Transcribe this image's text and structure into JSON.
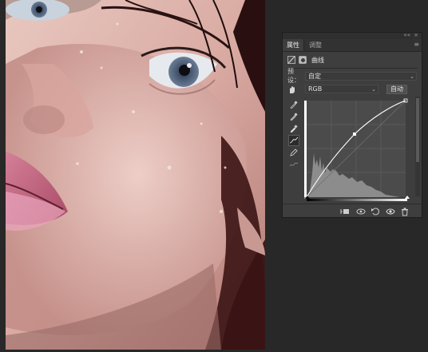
{
  "panel": {
    "tabs": [
      {
        "label": "属性",
        "active": true
      },
      {
        "label": "调整",
        "active": false
      }
    ],
    "top_controls": [
      "««",
      "×"
    ],
    "menu_icon": "panel-menu-icon",
    "adjustment_title": "曲线",
    "preset_label": "预设：",
    "preset_value": "自定",
    "channel_value": "RGB",
    "auto_button": "自动",
    "tools": [
      "target-adjust-hand-icon",
      "black-point-eyedropper-icon",
      "gray-point-eyedropper-icon",
      "white-point-eyedropper-icon",
      "curve-point-tool-icon",
      "pencil-draw-icon",
      "smooth-curve-icon"
    ],
    "bottom_icons": [
      "clip-to-layer-icon",
      "view-previous-state-icon",
      "reset-icon",
      "visibility-eye-icon",
      "trash-icon"
    ]
  },
  "colors": {
    "canvas_bg": "#282828",
    "panel_bg": "#3e3e3e",
    "curve_line": "#ffffff",
    "histogram": "#8a8a8a",
    "grid_bg": "#4b4b4b"
  }
}
